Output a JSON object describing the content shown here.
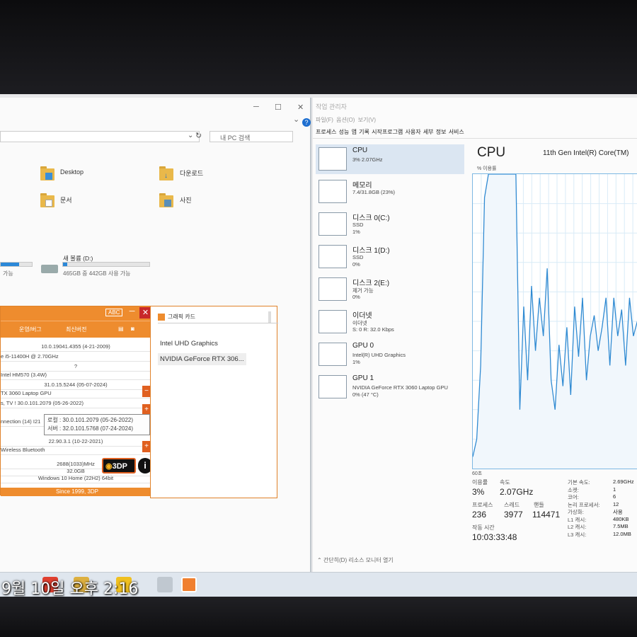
{
  "explorer": {
    "search_placeholder": "내 PC 검색",
    "folders": [
      {
        "label": "Desktop"
      },
      {
        "label": "다운로드"
      },
      {
        "label": "문서"
      },
      {
        "label": "사진"
      }
    ],
    "drive_c_text": "가능",
    "drive_d": {
      "label": "새 볼륨 (D:)",
      "space": "465GB 중 442GB 사용 가능",
      "used_fraction": 0.05
    }
  },
  "tdp": {
    "abc": "ABC",
    "menu": [
      "운영/버그",
      "최신버전"
    ],
    "rows": [
      {
        "text": "10.0.19041.4355 (4-21-2009)",
        "center": true
      },
      {
        "text": "e i5-11400H @ 2.70GHz",
        "center": false
      },
      {
        "text": "?",
        "center": true
      },
      {
        "text": "Intel HM570 (3.4W)",
        "center": false
      },
      {
        "text": "31.0.15.5244 (05-07-2024)",
        "center": true
      },
      {
        "text": "TX 3060 Laptop GPU",
        "center": false
      },
      {
        "text": "s, TV     !  30.0.101.2079 (05-26-2022)",
        "center": false
      },
      {
        "text": "nnection (14) I21",
        "center": false
      },
      {
        "text": "22.90.3.1 (10-22-2021)",
        "center": true
      },
      {
        "text": "Wireless Bluetooth",
        "center": false
      },
      {
        "text": "2688(1033)MHz",
        "center": true
      },
      {
        "text": "32.0GB",
        "center": true
      },
      {
        "text": "Windows 10 Home (22H2) 64bit",
        "center": true
      }
    ],
    "tooltip": [
      "로컬 : 30.0.101.2079 (05-26-2022)",
      "서버 : 32.0.101.5768 (07-24-2024)"
    ],
    "logo": "3DP",
    "info": "i",
    "footer": "Since 1999, 3DP"
  },
  "gpu_panel": {
    "title": "그래픽 카드",
    "items": [
      "Intel UHD Graphics",
      "NVIDIA GeForce RTX 306..."
    ]
  },
  "taskmgr": {
    "title": "작업 관리자",
    "menu": "파일(F)   옵션(O)   보기(V)",
    "tabs": "프로세스  성능  앱 기록  시작프로그램  사용자  세부 정보  서비스",
    "resources": [
      {
        "name": "CPU",
        "sub": [
          "3% 2.07GHz"
        ]
      },
      {
        "name": "메모리",
        "sub": [
          "7.4/31.8GB (23%)"
        ]
      },
      {
        "name": "디스크 0(C:)",
        "sub": [
          "SSD",
          "1%"
        ]
      },
      {
        "name": "디스크 1(D:)",
        "sub": [
          "SSD",
          "0%"
        ]
      },
      {
        "name": "디스크 2(E:)",
        "sub": [
          "제거 가능",
          "0%"
        ]
      },
      {
        "name": "이더넷",
        "sub": [
          "이더넷",
          "S: 0 R: 32.0 Kbps"
        ]
      },
      {
        "name": "GPU 0",
        "sub": [
          "Intel(R) UHD Graphics",
          "1%"
        ]
      },
      {
        "name": "GPU 1",
        "sub": [
          "NVIDIA GeForce RTX 3060 Laptop GPU",
          "0% (47 °C)"
        ]
      }
    ],
    "cpu_title": "CPU",
    "cpu_model": "11th Gen Intel(R) Core(TM)",
    "util_label": "% 이용률",
    "time_label": "60초",
    "stats": {
      "util_label": "이용률",
      "util": "3%",
      "speed_label": "속도",
      "speed": "2.07GHz",
      "proc_label": "프로세스",
      "proc": "236",
      "thread_label": "스레드",
      "thread": "3977",
      "handle_label": "핸들",
      "handle": "114471",
      "uptime_label": "작동 시간",
      "uptime": "10:03:33:48"
    },
    "info": [
      {
        "k": "기본 속도:",
        "v": "2.69GHz"
      },
      {
        "k": "소켓:",
        "v": "1"
      },
      {
        "k": "코어:",
        "v": "6"
      },
      {
        "k": "논리 프로세서:",
        "v": "12"
      },
      {
        "k": "가상화:",
        "v": "사용"
      },
      {
        "k": "L1 캐시:",
        "v": "480KB"
      },
      {
        "k": "L2 캐시:",
        "v": "7.5MB"
      },
      {
        "k": "L3 캐시:",
        "v": "12.0MB"
      }
    ],
    "footer": "간단히(D)   리소스 모니터 열기",
    "cpu_history": [
      4,
      10,
      35,
      92,
      100,
      100,
      100,
      100,
      100,
      100,
      100,
      100,
      20,
      55,
      30,
      62,
      40,
      58,
      45,
      68,
      30,
      20,
      42,
      28,
      48,
      25,
      55,
      38,
      58,
      30,
      45,
      52,
      40,
      48,
      58,
      35,
      58,
      45,
      54,
      35,
      58,
      45,
      50,
      40
    ]
  },
  "overlay_timestamp": "9월 10일 오후 2:16"
}
